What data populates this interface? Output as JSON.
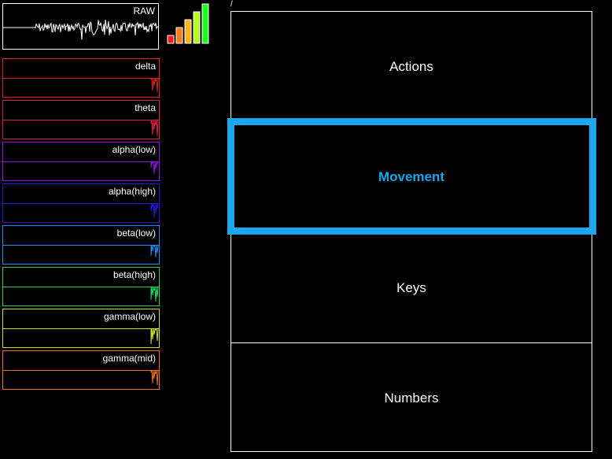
{
  "raw_panel": {
    "label": "RAW"
  },
  "signal_meter": {
    "level": 5,
    "max_level": 5,
    "colors": [
      "#ff1b1b",
      "#ff7a1b",
      "#ffb41b",
      "#b4ff1b",
      "#1bff1b"
    ]
  },
  "bands": [
    {
      "label": "delta",
      "color": "#e01e1e"
    },
    {
      "label": "theta",
      "color": "#e01e48"
    },
    {
      "label": "alpha(low)",
      "color": "#8c14e6"
    },
    {
      "label": "alpha(high)",
      "color": "#2814d8"
    },
    {
      "label": "beta(low)",
      "color": "#1e8cf0"
    },
    {
      "label": "beta(high)",
      "color": "#1ed85a"
    },
    {
      "label": "gamma(low)",
      "color": "#c8e61e"
    },
    {
      "label": "gamma(mid)",
      "color": "#f06e1e"
    }
  ],
  "breadcrumb": "/",
  "menu": {
    "items": [
      {
        "label": "Actions"
      },
      {
        "label": "Movement"
      },
      {
        "label": "Keys"
      },
      {
        "label": "Numbers"
      }
    ],
    "selected_index": 1,
    "highlight_color": "#1ea7ee"
  }
}
